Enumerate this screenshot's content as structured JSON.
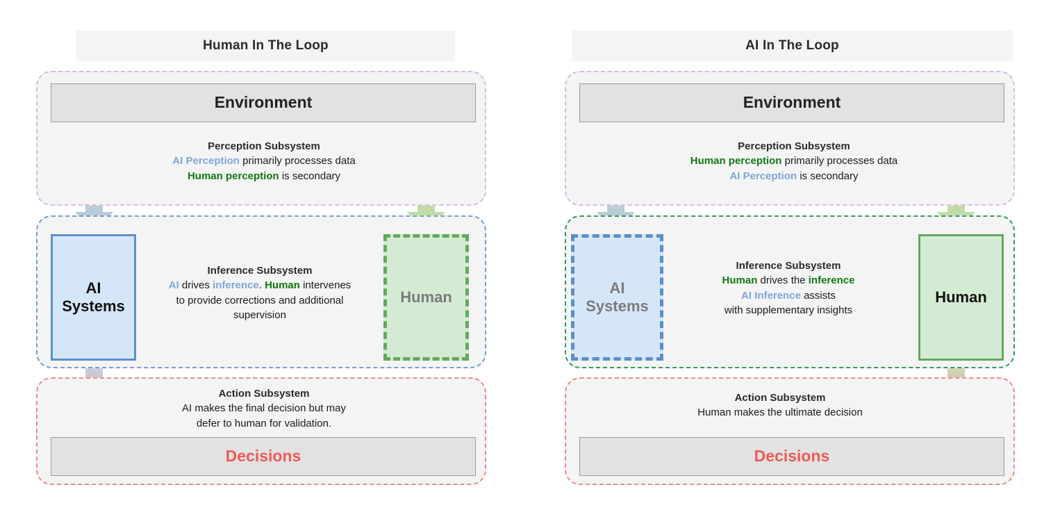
{
  "diagram": {
    "title_left": "Human In The Loop",
    "title_right": "AI In The Loop"
  },
  "colors": {
    "ai_blue": "#7da7d9",
    "ai_box_fill": "#d6e6f9",
    "ai_box_border": "#5b8fc9",
    "human_green": "#117a11",
    "human_box_fill": "#d4ebd3",
    "human_box_border": "#63a95e",
    "decisions_red": "#ef5a54",
    "environment_fill": "#e2e2e2",
    "perception_border": "#d9b8e8",
    "inference_border_left": "#6f9fd8",
    "inference_border_right": "#2e9e5b",
    "action_border": "#ef8a85",
    "muted_text": "#7b7b7b",
    "arrow_yellow": "#f2deA0",
    "arrow_blue": "#a9c6e4",
    "arrow_green": "#b2dba6",
    "arrow_red": "#ec7a74"
  },
  "left_panel": {
    "title": "Human In The Loop",
    "environment_label": "Environment",
    "decisions_label": "Decisions",
    "ai_label_line1": "AI",
    "ai_label_line2": "Systems",
    "human_label": "Human",
    "perception": {
      "heading": "Perception Subsystem",
      "line1_a": "AI Perception",
      "line1_b": " primarily processes data",
      "line2_a": "Human perception",
      "line2_b": " is secondary"
    },
    "inference": {
      "heading": "Inference Subsystem",
      "seg1_a": "AI",
      "seg1_b": " drives ",
      "seg1_c": "inference",
      "seg1_d": ". ",
      "seg1_e": "Human",
      "seg1_f": "  intervenes",
      "line2": "to provide corrections and additional",
      "line3": "supervision"
    },
    "action": {
      "heading": "Action Subsystem",
      "line1": "AI makes the final decision but may",
      "line2": "defer to human  for validation."
    }
  },
  "right_panel": {
    "title": "AI In The Loop",
    "environment_label": "Environment",
    "decisions_label": "Decisions",
    "ai_label_line1": "AI",
    "ai_label_line2": "Systems",
    "human_label": "Human",
    "perception": {
      "heading": "Perception Subsystem",
      "line1_a": "Human perception",
      "line1_b": " primarily processes data",
      "line2_a": "AI Perception",
      "line2_b": " is secondary"
    },
    "inference": {
      "heading": "Inference Subsystem",
      "seg1_a": "Human",
      "seg1_b": " drives the  ",
      "seg1_c": "inference",
      "seg2_a": "AI Inference",
      "seg2_b": " assists",
      "line3": "with supplementary insights"
    },
    "action": {
      "heading": "Action Subsystem",
      "line1": "Human makes the ultimate decision"
    }
  }
}
